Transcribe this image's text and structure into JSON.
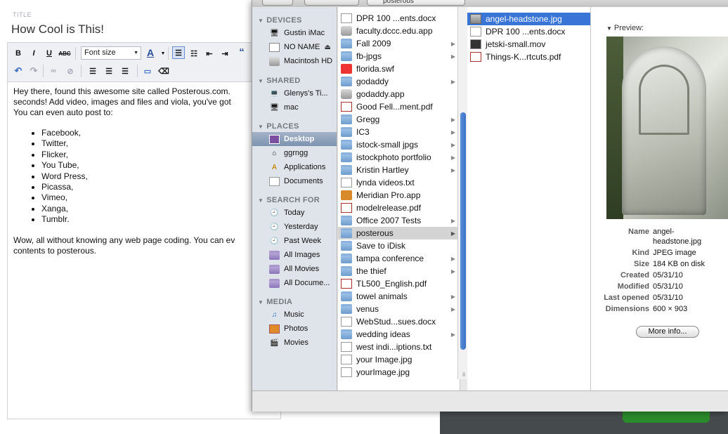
{
  "editor": {
    "title_label": "TITLE",
    "title_value": "How Cool is This!",
    "font_size_placeholder": "Font size",
    "toolbar": {
      "bold": "B",
      "italic": "I",
      "underline": "U",
      "strike": "ABC",
      "font_color": "A",
      "quote": "“"
    },
    "body": {
      "intro_lines": [
        "Hey there, found this awesome site called Posterous.com.",
        "seconds!  Add video, images and files and viola, you've got",
        "You can even auto post to:"
      ],
      "services": [
        "Facebook,",
        "Twitter,",
        "Flicker,",
        "You Tube,",
        "Word Press,",
        "Picassa,",
        "Vimeo,",
        "Xanga,",
        "Tumblr."
      ],
      "outro_lines": [
        "Wow, all without knowing any web page coding.  You can ev",
        "contents to posterous."
      ]
    }
  },
  "dialog": {
    "path_popup": "posterous",
    "sidebar": {
      "devices_header": "DEVICES",
      "devices": [
        "Gustin iMac",
        "NO NAME",
        "Macintosh HD"
      ],
      "shared_header": "SHARED",
      "shared": [
        "Glenys's Ti...",
        "mac"
      ],
      "places_header": "PLACES",
      "places": [
        "Desktop",
        "ggrngg",
        "Applications",
        "Documents"
      ],
      "search_header": "SEARCH FOR",
      "searches": [
        "Today",
        "Yesterday",
        "Past Week",
        "All Images",
        "All Movies",
        "All Docume..."
      ],
      "media_header": "MEDIA",
      "media": [
        "Music",
        "Photos",
        "Movies"
      ]
    },
    "main_column": [
      {
        "name": "DPR 100 ...ents.docx",
        "kind": "doc",
        "folder": false
      },
      {
        "name": "faculty.dccc.edu.app",
        "kind": "app",
        "folder": false
      },
      {
        "name": "Fall 2009",
        "kind": "folder",
        "folder": true
      },
      {
        "name": "fb-jpgs",
        "kind": "folder",
        "folder": true
      },
      {
        "name": "florida.swf",
        "kind": "red",
        "folder": false
      },
      {
        "name": "godaddy",
        "kind": "folder",
        "folder": true
      },
      {
        "name": "godaddy.app",
        "kind": "app",
        "folder": false
      },
      {
        "name": "Good Fell...ment.pdf",
        "kind": "pdf",
        "folder": false
      },
      {
        "name": "Gregg",
        "kind": "folder",
        "folder": true
      },
      {
        "name": "IC3",
        "kind": "folder",
        "folder": true
      },
      {
        "name": "istock-small jpgs",
        "kind": "folder",
        "folder": true
      },
      {
        "name": "istockphoto portfolio",
        "kind": "folder",
        "folder": true
      },
      {
        "name": "Kristin Hartley",
        "kind": "folder",
        "folder": true
      },
      {
        "name": "lynda videos.txt",
        "kind": "doc",
        "folder": false
      },
      {
        "name": "Meridian Pro.app",
        "kind": "orange",
        "folder": false
      },
      {
        "name": "modelrelease.pdf",
        "kind": "pdf",
        "folder": false
      },
      {
        "name": "Office 2007 Tests",
        "kind": "folder",
        "folder": true
      },
      {
        "name": "posterous",
        "kind": "folder",
        "folder": true,
        "selected": true
      },
      {
        "name": "Save to iDisk",
        "kind": "folder",
        "folder": false
      },
      {
        "name": "tampa conference",
        "kind": "folder",
        "folder": true
      },
      {
        "name": "the thief",
        "kind": "folder",
        "folder": true
      },
      {
        "name": "TL500_English.pdf",
        "kind": "pdf",
        "folder": false
      },
      {
        "name": "towel animals",
        "kind": "folder",
        "folder": true
      },
      {
        "name": "venus",
        "kind": "folder",
        "folder": true
      },
      {
        "name": "WebStud...sues.docx",
        "kind": "doc",
        "folder": false
      },
      {
        "name": "wedding ideas",
        "kind": "folder",
        "folder": true
      },
      {
        "name": "west indi...iptions.txt",
        "kind": "doc",
        "folder": false
      },
      {
        "name": "your Image.jpg",
        "kind": "doc",
        "folder": false
      },
      {
        "name": "yourImage.jpg",
        "kind": "doc",
        "folder": false
      }
    ],
    "files_column": [
      {
        "name": "angel-headstone.jpg",
        "kind": "img",
        "selected": true
      },
      {
        "name": "DPR 100 ...ents.docx",
        "kind": "doc"
      },
      {
        "name": "jetski-small.mov",
        "kind": "mov"
      },
      {
        "name": "Things-K...rtcuts.pdf",
        "kind": "pdf"
      }
    ],
    "preview": {
      "label": "Preview:",
      "name_label": "Name",
      "name_value_1": "angel-",
      "name_value_2": "headstone.jpg",
      "kind_label": "Kind",
      "kind_value": "JPEG image",
      "size_label": "Size",
      "size_value": "184 KB on disk",
      "created_label": "Created",
      "created_value": "05/31/10",
      "modified_label": "Modified",
      "modified_value": "05/31/10",
      "opened_label": "Last opened",
      "opened_value": "05/31/10",
      "dims_label": "Dimensions",
      "dims_value": "600 × 903",
      "more_info": "More info..."
    }
  }
}
